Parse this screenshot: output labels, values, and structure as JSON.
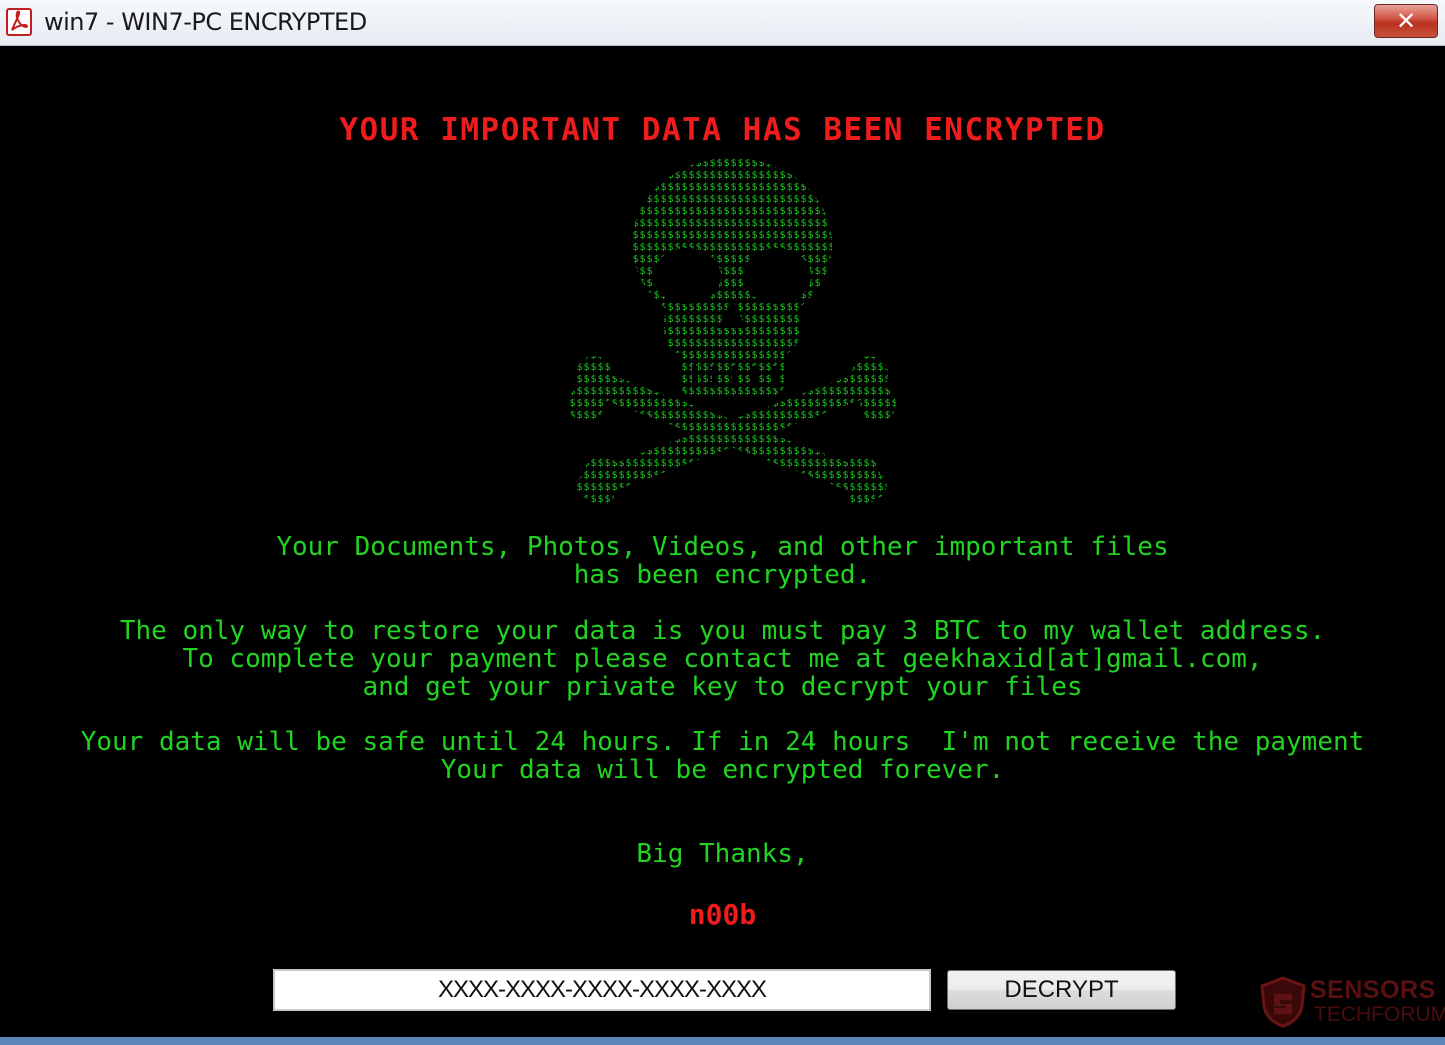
{
  "window": {
    "title": "win7 - WIN7-PC ENCRYPTED",
    "app_icon": "pdf-document-icon",
    "close_icon": "close-x-icon"
  },
  "ransom_note": {
    "headline": "YOUR IMPORTANT DATA HAS BEEN ENCRYPTED",
    "art": "skull-and-crossbones-ascii-art",
    "paragraph1": "Your Documents, Photos, Videos, and other important files\nhas been encrypted.",
    "paragraph2": "The only way to restore your data is you must pay 3 BTC to my wallet address.\nTo complete your payment please contact me at geekhaxid[at]gmail.com,\nand get your private key to decrypt your files",
    "paragraph3": "Your data will be safe until 24 hours. If in 24 hours  I'm not receive the payment\nYour data will be encrypted forever.",
    "closing": "Big Thanks,",
    "signature": "n00b"
  },
  "decrypt_form": {
    "key_value": "XXXX-XXXX-XXXX-XXXX-XXXX",
    "button_label": "DECRYPT"
  },
  "watermark": {
    "line1": "SENSORS",
    "line2": "TECHFORUM"
  },
  "colors": {
    "background": "#000000",
    "headline_red": "#ee1c1c",
    "text_green": "#22d422"
  }
}
